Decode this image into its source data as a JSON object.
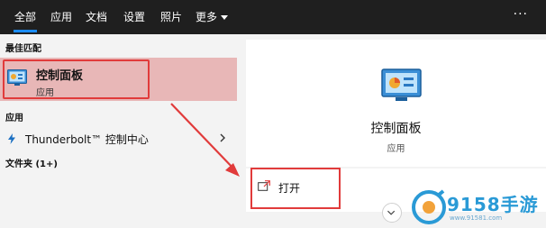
{
  "tabs": [
    {
      "label": "全部"
    },
    {
      "label": "应用"
    },
    {
      "label": "文档"
    },
    {
      "label": "设置"
    },
    {
      "label": "照片"
    },
    {
      "label": "更多"
    }
  ],
  "more_icon": "ellipsis-icon",
  "left_panel": {
    "best_match_heading": "最佳匹配",
    "best_match": {
      "title": "控制面板",
      "subtitle": "应用",
      "icon": "control-panel-icon"
    },
    "apps_heading": "应用",
    "apps": [
      {
        "label": "Thunderbolt™ 控制中心",
        "icon": "thunderbolt-icon"
      }
    ],
    "folders_heading": "文件夹 (1+)"
  },
  "right_panel": {
    "title": "控制面板",
    "subtitle": "应用",
    "actions": [
      {
        "label": "打开",
        "icon": "open-icon"
      }
    ]
  },
  "watermark": {
    "text": "9158手游",
    "url": "www.91581.com"
  },
  "colors": {
    "accent": "#1a8cff",
    "highlight": "#e8b7b7",
    "annotation_red": "#e13b3b",
    "topbar": "#1f1f1f"
  }
}
